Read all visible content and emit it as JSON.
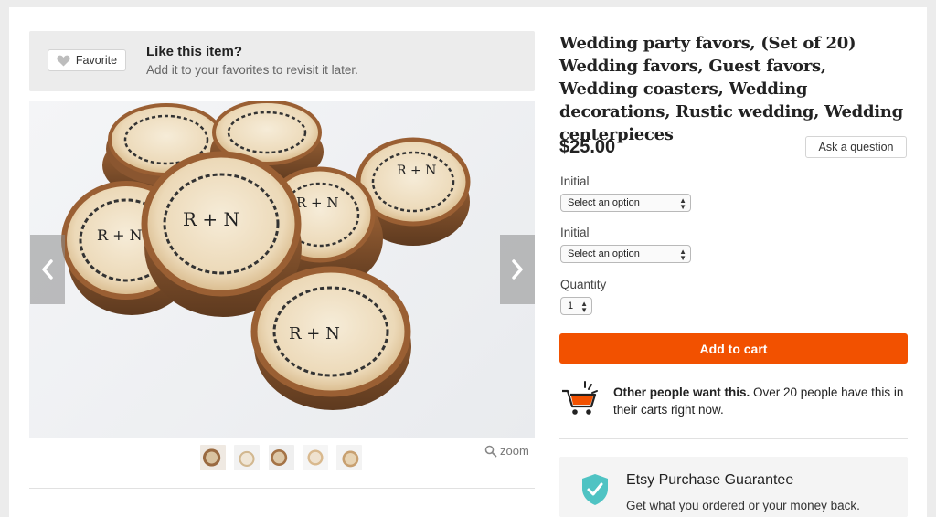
{
  "favorite": {
    "button_label": "Favorite",
    "title": "Like this item?",
    "subtitle": "Add it to your favorites to revisit it later."
  },
  "gallery": {
    "main_image": "wooden slice wedding coasters stamped with R + N floral heart design",
    "prev_icon": "chevron-left-icon",
    "next_icon": "chevron-right-icon",
    "thumbnails": [
      "thumb-1",
      "thumb-2",
      "thumb-3",
      "thumb-4",
      "thumb-5"
    ],
    "zoom_label": "zoom",
    "monogram": "R + N"
  },
  "product": {
    "title": "Wedding party favors, (Set of 20) Wedding favors, Guest favors, Wedding coasters, Wedding decorations, Rustic wedding, Wedding centerpieces",
    "price": "$25.00",
    "ask_label": "Ask a question"
  },
  "options": [
    {
      "label": "Initial",
      "value": "Select an option"
    },
    {
      "label": "Initial",
      "value": "Select an option"
    }
  ],
  "quantity": {
    "label": "Quantity",
    "value": "1"
  },
  "cart": {
    "button_label": "Add to cart",
    "demand_bold": "Other people want this.",
    "demand_rest": " Over 20 people have this in their carts right now."
  },
  "guarantee": {
    "title": "Etsy Purchase Guarantee",
    "subtitle": "Get what you ordered or your money back."
  },
  "colors": {
    "accent": "#f25100",
    "shield": "#4fc3c3",
    "banner_bg": "#ececec"
  }
}
